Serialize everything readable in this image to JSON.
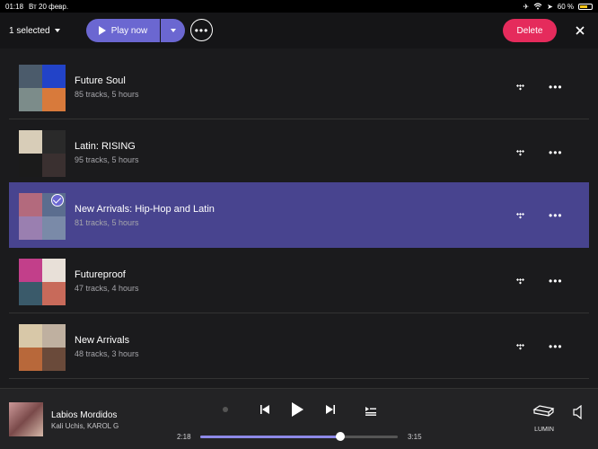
{
  "status": {
    "time": "01:18",
    "date": "Вт 20 февр.",
    "battery": "60 %"
  },
  "toolbar": {
    "selected_label": "1 selected",
    "play_label": "Play now",
    "more_label": "•••",
    "delete_label": "Delete"
  },
  "playlists": [
    {
      "title": "Future Soul",
      "subtitle": "85 tracks, 5 hours",
      "selected": false,
      "art": [
        "#4b5b6b",
        "#2243c8",
        "#7c8c8a",
        "#d87a3b"
      ]
    },
    {
      "title": "Latin: RISING",
      "subtitle": "95 tracks, 5 hours",
      "selected": false,
      "art": [
        "#d8cdb8",
        "#2a2a2a",
        "#1b1b1b",
        "#3a3030"
      ]
    },
    {
      "title": "New Arrivals: Hip-Hop and Latin",
      "subtitle": "81 tracks, 5 hours",
      "selected": true,
      "art": [
        "#b36a7d",
        "#5b6d8f",
        "#9a7fb0",
        "#7a8aa8"
      ]
    },
    {
      "title": "Futureproof",
      "subtitle": "47 tracks, 4 hours",
      "selected": false,
      "art": [
        "#c23f8a",
        "#e8e0d8",
        "#3a5a6a",
        "#c86a5a"
      ]
    },
    {
      "title": "New Arrivals",
      "subtitle": "48 tracks, 3 hours",
      "selected": false,
      "art": [
        "#d8c8a8",
        "#bfb0a0",
        "#b8683a",
        "#6a4a3a"
      ]
    }
  ],
  "player": {
    "title": "Labios Mordidos",
    "artist": "Kali Uchis, KAROL G",
    "elapsed": "2:18",
    "duration": "3:15",
    "progress": 0.71,
    "device_label": "LUMIN"
  },
  "colors": {
    "accent": "#6b67d1",
    "delete": "#e52b5c",
    "selected_row": "#48448f"
  }
}
